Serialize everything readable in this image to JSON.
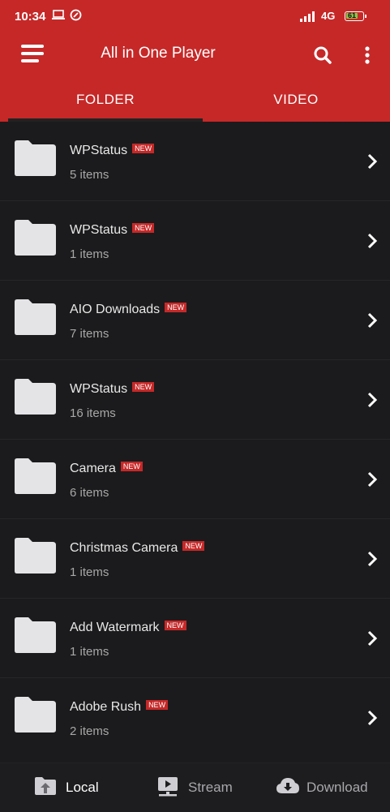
{
  "status_bar": {
    "time": "10:34",
    "network": "4G",
    "battery_level": "61"
  },
  "app_bar": {
    "title": "All in One Player",
    "menu_icon": "hamburger-menu-icon",
    "search_icon": "search-icon",
    "more_icon": "more-vert-icon"
  },
  "tabs": [
    {
      "label": "FOLDER",
      "selected": true
    },
    {
      "label": "VIDEO",
      "selected": false
    }
  ],
  "folders": [
    {
      "name": "WPStatus",
      "badge": "NEW",
      "count": "5 items"
    },
    {
      "name": "WPStatus",
      "badge": "NEW",
      "count": "1 items"
    },
    {
      "name": "AIO Downloads",
      "badge": "NEW",
      "count": "7 items"
    },
    {
      "name": "WPStatus",
      "badge": "NEW",
      "count": "16 items"
    },
    {
      "name": "Camera",
      "badge": "NEW",
      "count": "6 items"
    },
    {
      "name": "Christmas Camera",
      "badge": "NEW",
      "count": "1 items"
    },
    {
      "name": "Add Watermark",
      "badge": "NEW",
      "count": "1 items"
    },
    {
      "name": "Adobe Rush",
      "badge": "NEW",
      "count": "2 items"
    }
  ],
  "bottom_nav": [
    {
      "label": "Local",
      "icon": "local-folder-icon",
      "active": true
    },
    {
      "label": "Stream",
      "icon": "stream-icon",
      "active": false
    },
    {
      "label": "Download",
      "icon": "download-cloud-icon",
      "active": false
    }
  ],
  "colors": {
    "primary": "#c62828",
    "background": "#1b1b1d",
    "folder_icon": "#e4e4e7"
  }
}
